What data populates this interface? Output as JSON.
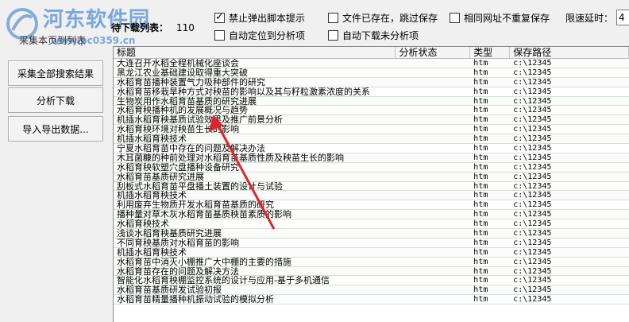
{
  "watermark": {
    "title": "河东软件园",
    "url": "www.pc0359.cn"
  },
  "toolbar": {
    "tab_label": "采集本页到列表",
    "pending_label": "待下载列表：",
    "pending_count": "110",
    "cb_disable_popup": "禁止弹出脚本提示",
    "cb_skip_exists": "文件已存在，跳过保存",
    "cb_no_dup_url": "相同网址不重复保存",
    "cb_auto_locate": "自动定位到分析项",
    "cb_auto_download": "自动下载未分析项",
    "delay_label": "限速延时：",
    "delay_value": "4"
  },
  "buttons": {
    "collect_all": "采集全部搜索结果",
    "analyze_download": "分析下载",
    "import_export": "导入导出数据..."
  },
  "table": {
    "headers": {
      "title": "标题",
      "status": "分析状态",
      "type": "类型",
      "path": "保存路径"
    },
    "rows": [
      {
        "title": "大连召开水稻全程机械化座谈会",
        "status": "",
        "type": "htm",
        "path": "c:\\12345"
      },
      {
        "title": "黑龙江农业基础建设取得重大突破",
        "status": "",
        "type": "htm",
        "path": "c:\\12345"
      },
      {
        "title": "水稻育苗播种装置气力吸种部件的研究",
        "status": "",
        "type": "htm",
        "path": "c:\\12345"
      },
      {
        "title": "水稻育苗移栽旱种方式对秧苗的影响以及其与籽粒激素浓度的关系",
        "status": "",
        "type": "htm",
        "path": "c:\\12345"
      },
      {
        "title": "生物炭用作水稻育苗基质的研究进展",
        "status": "",
        "type": "htm",
        "path": "c:\\12345"
      },
      {
        "title": "水稻育秧播种机的发展概况与趋势",
        "status": "",
        "type": "htm",
        "path": "c:\\12345"
      },
      {
        "title": "机插水稻育秧基质试验效果及推广前景分析",
        "status": "",
        "type": "htm",
        "path": "c:\\12345"
      },
      {
        "title": "水稻育秧环境对秧苗生长的影响",
        "status": "",
        "type": "htm",
        "path": "c:\\12345"
      },
      {
        "title": "机插水稻育秧技术",
        "status": "",
        "type": "htm",
        "path": "c:\\12345"
      },
      {
        "title": "宁夏水稻育苗中存在的问题及解决办法",
        "status": "",
        "type": "htm",
        "path": "c:\\12345"
      },
      {
        "title": "木耳菌糠的种前处理对水稻育苗基质性质及秧苗生长的影响",
        "status": "",
        "type": "htm",
        "path": "c:\\12345"
      },
      {
        "title": "水稻育秧软塑穴盘播种设备研究",
        "status": "",
        "type": "htm",
        "path": "c:\\12345"
      },
      {
        "title": "水稻育苗基质研究进展",
        "status": "",
        "type": "htm",
        "path": "c:\\12345"
      },
      {
        "title": "刮板式水稻育苗平盘播土装置的设计与试验",
        "status": "",
        "type": "htm",
        "path": "c:\\12345"
      },
      {
        "title": "机插水稻育秧技术",
        "status": "",
        "type": "htm",
        "path": "c:\\12345"
      },
      {
        "title": "利用废弃生物质开发水稻育苗基质的研究",
        "status": "",
        "type": "htm",
        "path": "c:\\12345"
      },
      {
        "title": "播种量对草木灰水稻育苗基质秧苗素质的影响",
        "status": "",
        "type": "htm",
        "path": "c:\\12345"
      },
      {
        "title": "水稻育秧技术",
        "status": "",
        "type": "htm",
        "path": "c:\\12345"
      },
      {
        "title": "浅谈水稻育秧基质研究进展",
        "status": "",
        "type": "htm",
        "path": "c:\\12345"
      },
      {
        "title": "不同育秧基质对水稻育苗的影响",
        "status": "",
        "type": "htm",
        "path": "c:\\12345"
      },
      {
        "title": "机插水稻育秧技术",
        "status": "",
        "type": "htm",
        "path": "c:\\12345"
      },
      {
        "title": "水稻育苗中消灭小棚推广大中棚的主要的措施",
        "status": "",
        "type": "htm",
        "path": "c:\\12345"
      },
      {
        "title": "水稻育苗存在的问题及解决方法",
        "status": "",
        "type": "htm",
        "path": "c:\\12345"
      },
      {
        "title": "智能化水稻育秧棚监控系统的设计与应用-基于多机通信",
        "status": "",
        "type": "htm",
        "path": "c:\\12345"
      },
      {
        "title": "水稻育苗基质研发试验初报",
        "status": "",
        "type": "htm",
        "path": "c:\\12345"
      },
      {
        "title": "水稻育苗精量播种机振动试验的模拟分析",
        "status": "",
        "type": "htm",
        "path": "c:\\12345"
      }
    ]
  },
  "annotation": {
    "arrow_color": "#e0242a"
  }
}
